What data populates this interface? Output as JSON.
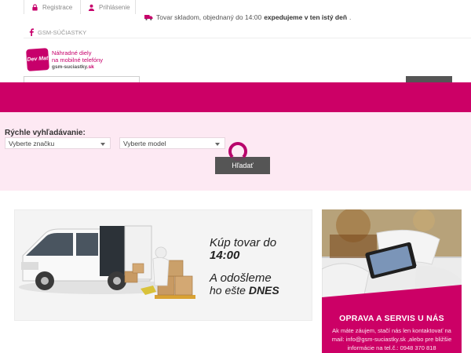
{
  "topbar": {
    "register_label": "Registrace",
    "login_label": "Prihlásenie",
    "shipping_before": "Tovar skladom, objednaný do 14:00",
    "shipping_bold": "expedujeme v ten istý deň",
    "shipping_after": ".",
    "facebook_label": "GSM-SÚČIASTKY"
  },
  "logo": {
    "mark_text": "Dev Mat",
    "line1": "Náhradné diely",
    "line2": "na mobilné telefóny",
    "domain_main": "gsm-suciastky",
    "domain_tld": ".sk"
  },
  "quick_search": {
    "title": "Rýchle vyhľadávanie:",
    "brand_value": "Vyberte značku",
    "model_value": "Vyberte model",
    "search_button": "Hľadať"
  },
  "promo": {
    "line1": "Kúp tovar do",
    "line2": "14:00",
    "line3": "A odošleme",
    "line4_prefix": "ho ešte",
    "line4_bold": "DNES"
  },
  "repair": {
    "title": "OPRAVA A SERVIS U NÁS",
    "text": "Ak máte záujem, stačí nás len kontaktovať na mail: info@gsm-suciastky.sk ,alebo pre bližšie informácie na tel.č.: 0948 370 818"
  },
  "colors": {
    "brand_magenta": "#cc0066",
    "quick_search_bg": "#fde9f3",
    "button_gray": "#555555"
  },
  "icons": [
    "lock-icon",
    "user-icon",
    "truck-icon",
    "facebook-icon",
    "chevron-down-icon",
    "loading-spinner-icon"
  ]
}
